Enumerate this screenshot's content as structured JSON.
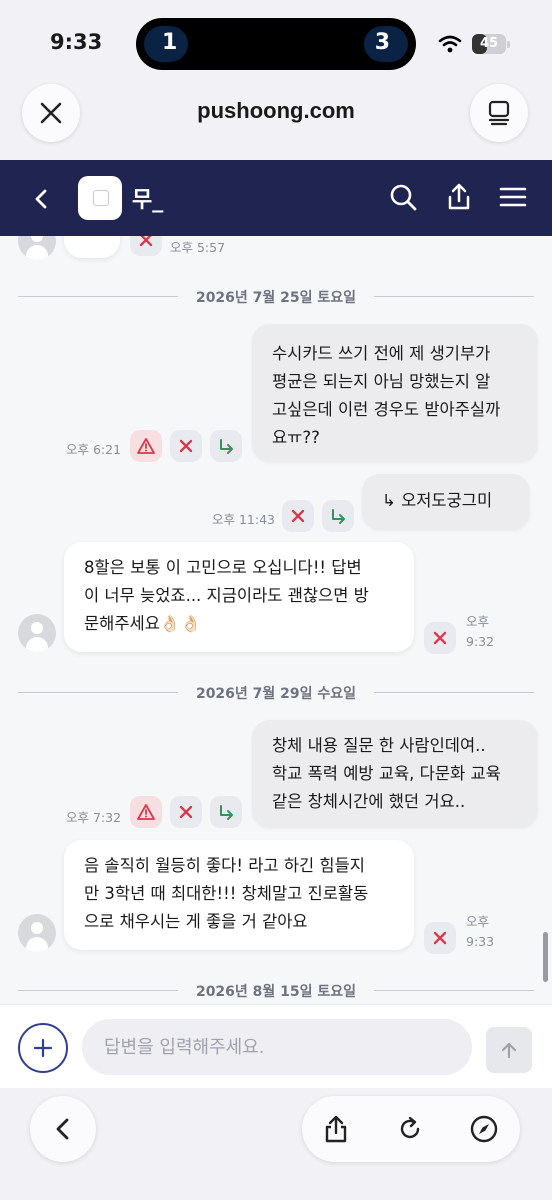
{
  "status_bar": {
    "time": "9:33",
    "island_left": "1",
    "island_right": "3",
    "battery": "45",
    "battery_level": 0.45
  },
  "browser": {
    "url": "pushoong.com"
  },
  "header": {
    "chat_name": "무_"
  },
  "chat": {
    "top_partial_time": "오후 5:57",
    "dates": [
      "2026년 7월 25일 토요일",
      "2026년 7월 29일 수요일",
      "2026년 8월 15일 토요일"
    ],
    "messages": [
      {
        "lines": [
          "수시카드 쓰기 전에 제 생기부가",
          "평균은 되는지 아님 망했는지 알",
          "고싶은데 이런 경우도 받아주실까",
          "요ㅠ??"
        ],
        "time": "오후 6:21"
      },
      {
        "text": "↳ 오저도궁그미",
        "time": "오후 11:43"
      },
      {
        "lines": [
          "8할은 보통 이 고민으로 오십니다!! 답변",
          "이 너무 늦었죠... 지금이라도 괜찮으면 방",
          "문해주세요👌🏻👌🏻"
        ],
        "time_a": "오후",
        "time_b": "9:32"
      },
      {
        "lines": [
          "창체 내용 질문 한 사람인데여..",
          "학교 폭력 예방 교육, 다문화 교육",
          "같은 창체시간에 했던 거요.."
        ],
        "time": "오후 7:32"
      },
      {
        "lines": [
          "음 솔직히 월등히 좋다! 라고 하긴 힘들지",
          "만 3학년 때 최대한!!! 창체말고 진로활동",
          "으로 채우시는 게 좋을 거 같아요"
        ],
        "time_a": "오후",
        "time_b": "9:33"
      }
    ]
  },
  "composer": {
    "placeholder": "답변을 입력해주세요."
  },
  "colors": {
    "header_bg": "#1f2550",
    "accent": "#2f3f96",
    "delete_red": "#d8384a",
    "reply_green": "#3a8f5a"
  }
}
